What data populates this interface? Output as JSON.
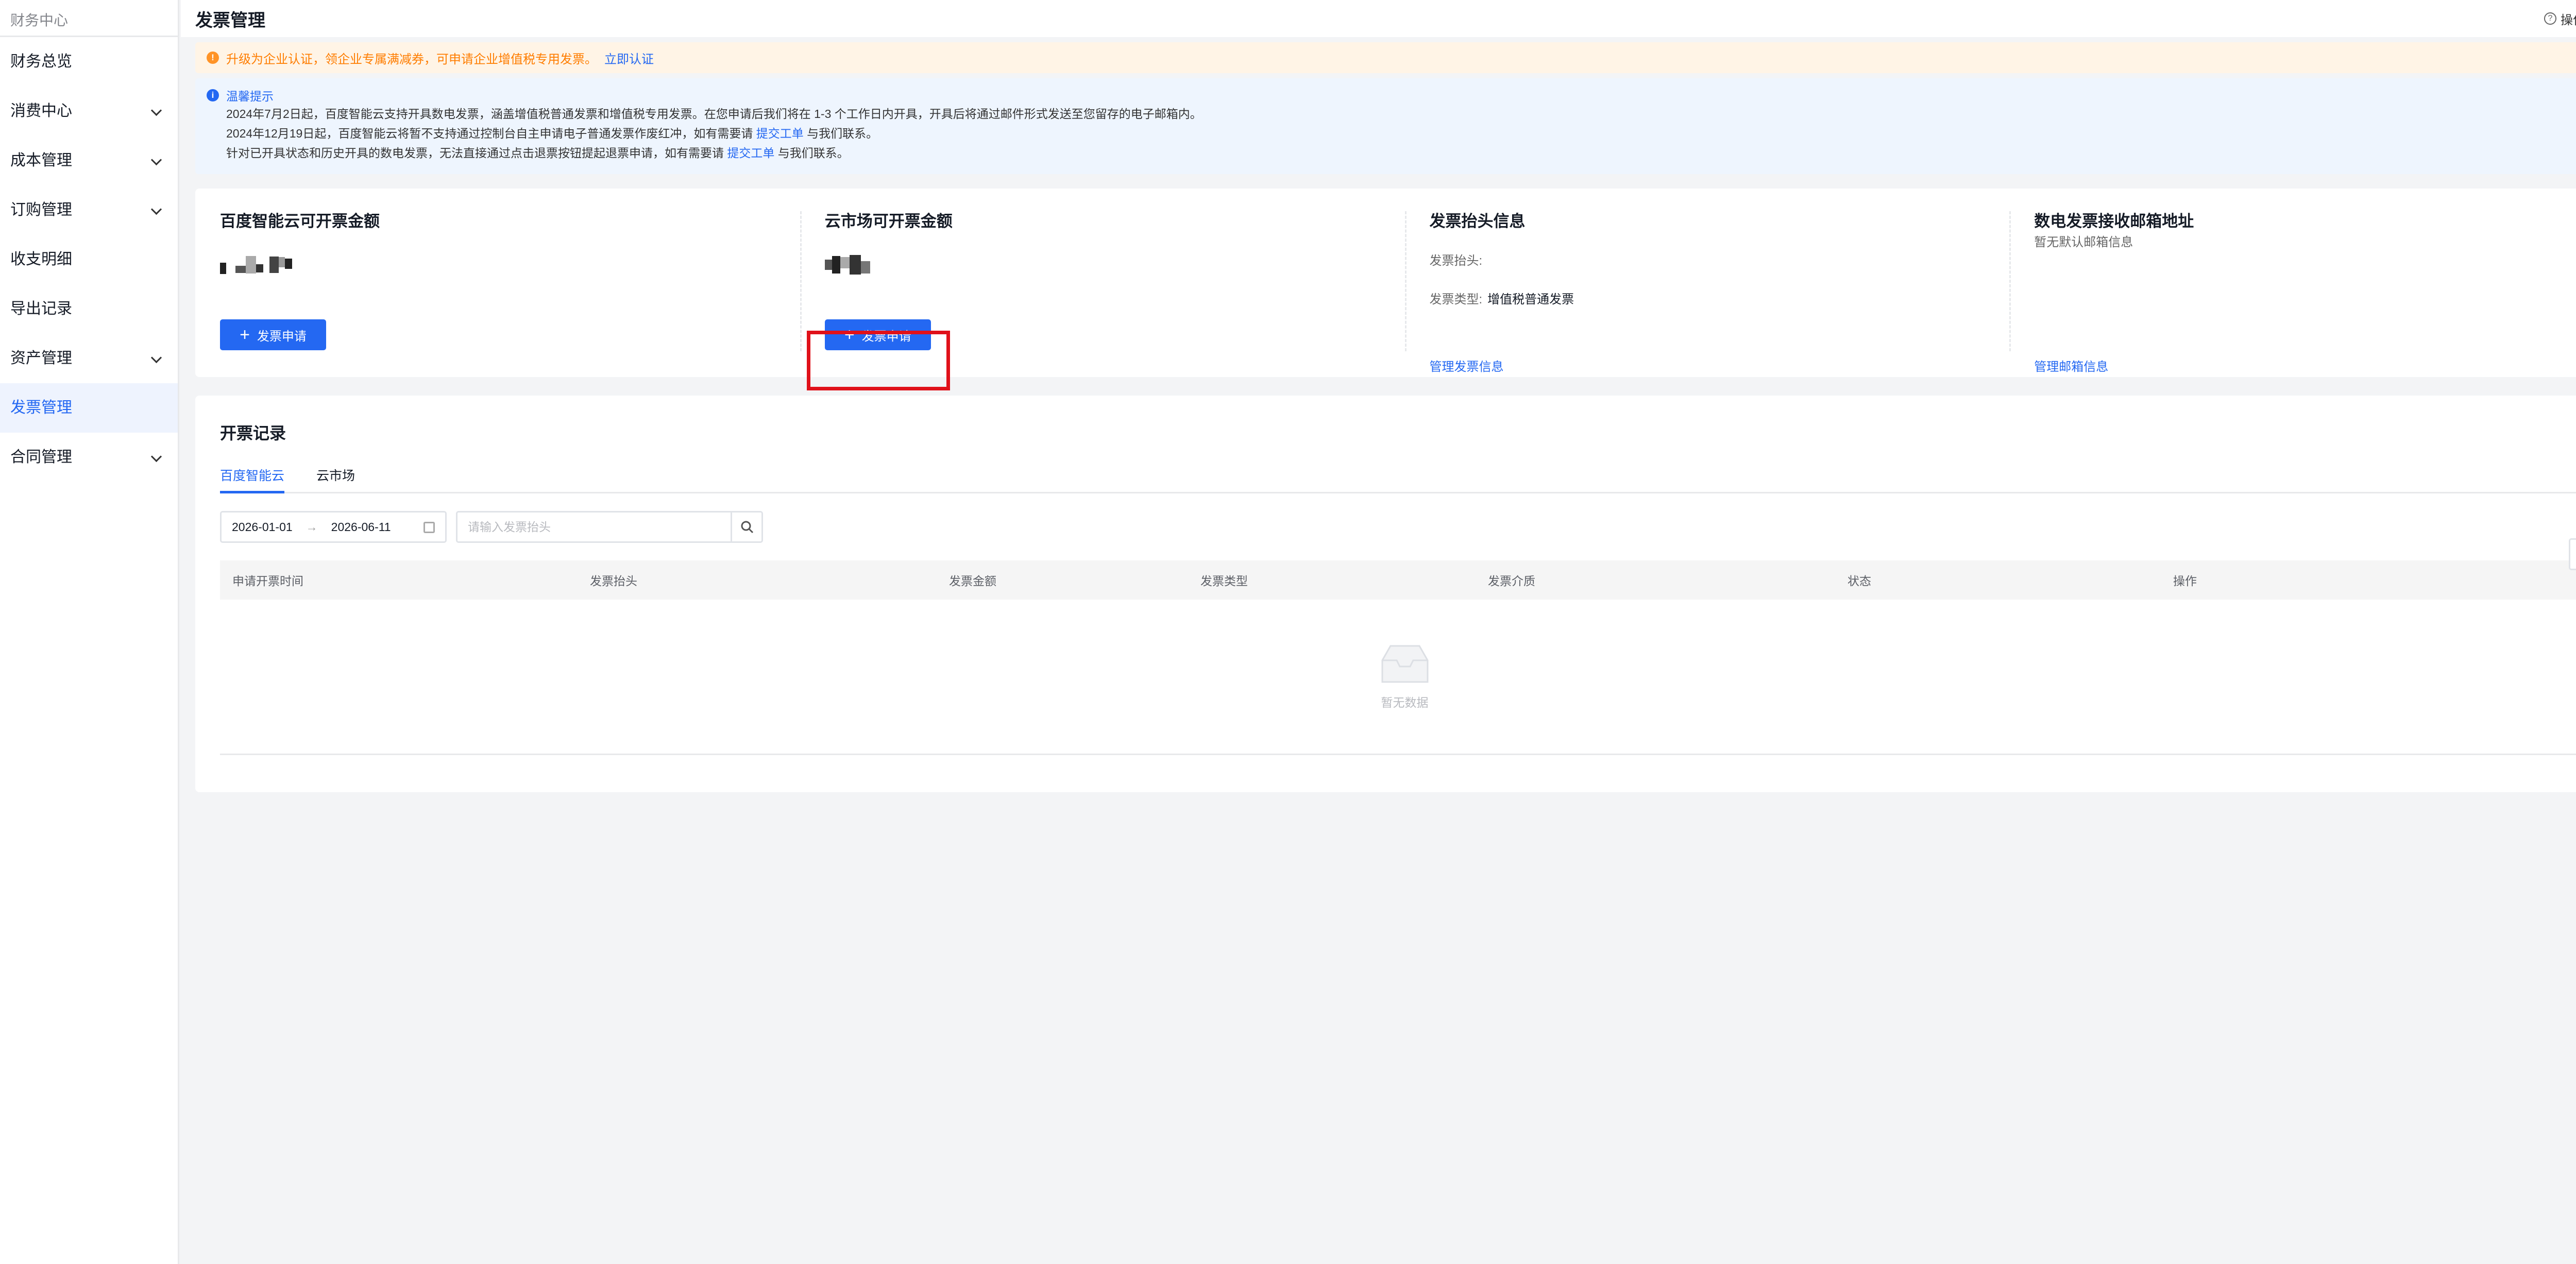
{
  "sidebar": {
    "title": "财务中心",
    "items": [
      {
        "label": "财务总览",
        "expandable": false,
        "active": false
      },
      {
        "label": "消费中心",
        "expandable": true,
        "active": false
      },
      {
        "label": "成本管理",
        "expandable": true,
        "active": false
      },
      {
        "label": "订购管理",
        "expandable": true,
        "active": false
      },
      {
        "label": "收支明细",
        "expandable": false,
        "active": false
      },
      {
        "label": "导出记录",
        "expandable": false,
        "active": false
      },
      {
        "label": "资产管理",
        "expandable": true,
        "active": false
      },
      {
        "label": "发票管理",
        "expandable": false,
        "active": true
      },
      {
        "label": "合同管理",
        "expandable": true,
        "active": false
      }
    ]
  },
  "header": {
    "title": "发票管理",
    "guide_label": "操作指南"
  },
  "warning_banner": {
    "text": "升级为企业认证，领企业专属满减券，可申请企业增值税专用发票。",
    "link": "立即认证"
  },
  "info_banner": {
    "title": "温馨提示",
    "line1": "2024年7月2日起，百度智能云支持开具数电发票，涵盖增值税普通发票和增值税专用发票。在您申请后我们将在 1-3 个工作日内开具，开具后将通过邮件形式发送至您留存的电子邮箱内。",
    "line2_pre": "2024年12月19日起，百度智能云将暂不支持通过控制台自主申请电子普通发票作废红冲，如有需要请",
    "line2_link": "提交工单",
    "line2_post": "与我们联系。",
    "line3_pre": "针对已开具状态和历史开具的数电发票，无法直接通过点击退票按钮提起退票申请，如有需要请",
    "line3_link": "提交工单",
    "line3_post": "与我们联系。"
  },
  "summary": {
    "baidu": {
      "title": "百度智能云可开票金额",
      "button": "发票申请"
    },
    "market": {
      "title": "云市场可开票金额",
      "button": "发票申请"
    },
    "invoice_header": {
      "title": "发票抬头信息",
      "header_label": "发票抬头:",
      "header_value": "",
      "type_label": "发票类型:",
      "type_value": "增值税普通发票",
      "link": "管理发票信息"
    },
    "email": {
      "title": "数电发票接收邮箱地址",
      "subtitle": "暂无默认邮箱信息",
      "link": "管理邮箱信息"
    }
  },
  "records": {
    "title": "开票记录",
    "tabs": [
      "百度智能云",
      "云市场"
    ],
    "active_tab": 0,
    "date_start": "2026-01-01",
    "date_sep": "→",
    "date_end": "2026-06-11",
    "search_placeholder": "请输入发票抬头",
    "columns": [
      "申请开票时间",
      "发票抬头",
      "发票金额",
      "发票类型",
      "发票介质",
      "状态",
      "操作"
    ],
    "rows": [],
    "empty_text": "暂无数据"
  },
  "colors": {
    "primary": "#2468f2",
    "warning": "#ff7d00",
    "highlight": "#e0111a"
  }
}
